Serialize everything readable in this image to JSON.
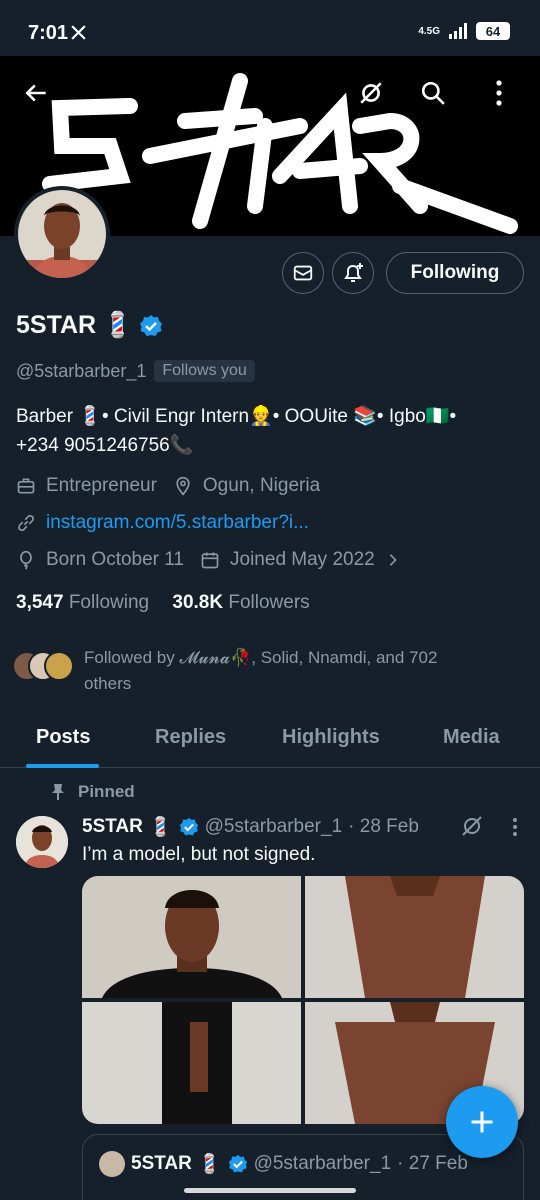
{
  "status": {
    "time": "7:01",
    "network": "4.5G",
    "battery": "64"
  },
  "banner": {
    "logo_text": "5STAR"
  },
  "actions": {
    "following_label": "Following"
  },
  "profile": {
    "name": "5STAR",
    "name_emoji": "💈",
    "handle": "@5starbarber_1",
    "follows_you": "Follows you",
    "bio_line1": "Barber 💈• Civil Engr Intern👷• OOUite 📚• Igbo🇳🇬•",
    "bio_line2": "+234 9051246756📞",
    "profession": "Entrepreneur",
    "location": "Ogun, Nigeria",
    "link": "instagram.com/5.starbarber?i...",
    "born": "Born October 11",
    "joined": "Joined May 2022",
    "following_count": "3,547",
    "following_label": "Following",
    "followers_count": "30.8K",
    "followers_label": "Followers",
    "followed_by_prefix": "Followed by ",
    "followed_by_names": "𝓜𝓾𝓷𝓪🥀, Solid, Nnamdi, and 702",
    "followed_by_suffix": "others"
  },
  "tabs": [
    "Posts",
    "Replies",
    "Highlights",
    "Media"
  ],
  "pinned_label": "Pinned",
  "post": {
    "name": "5STAR",
    "emoji": "💈",
    "handle": "@5starbarber_1",
    "date": "· 28 Feb",
    "text": "I’m a model, but not signed."
  },
  "quote": {
    "name": "5STAR",
    "emoji": "💈",
    "handle": "@5starbarber_1",
    "date": "· 27 Feb"
  },
  "colors": {
    "accent": "#1d9bf0",
    "background": "#15202b",
    "muted": "#8b98a5"
  },
  "icons": [
    "back-arrow-icon",
    "grok-icon",
    "search-icon",
    "more-vertical-icon",
    "mail-icon",
    "bell-plus-icon",
    "verified-icon",
    "briefcase-icon",
    "location-icon",
    "link-icon",
    "balloon-icon",
    "calendar-icon",
    "chevron-right-icon",
    "pin-icon",
    "plus-icon"
  ]
}
